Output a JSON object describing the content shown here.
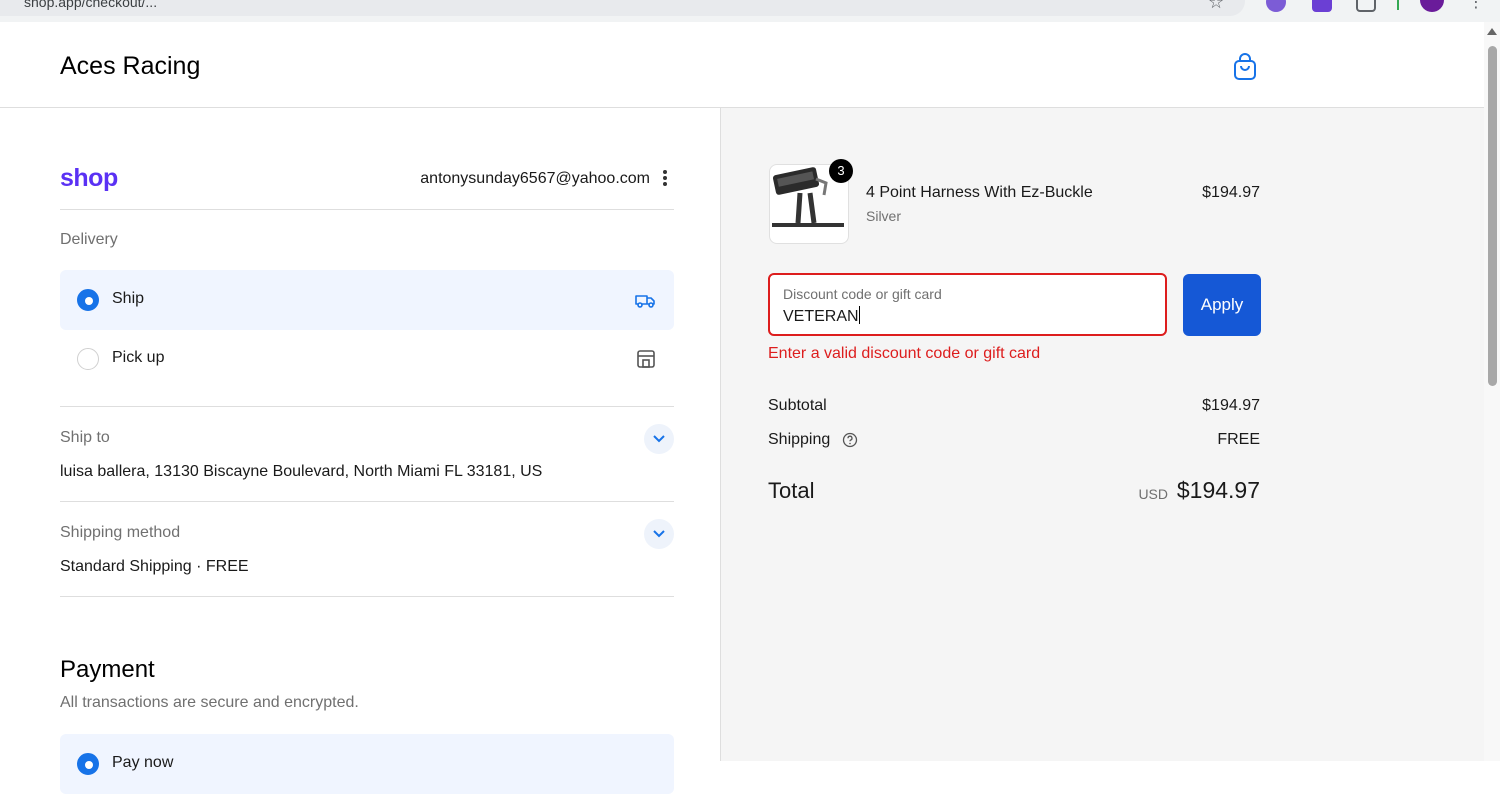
{
  "browser": {
    "url": "shop.app/checkout/...",
    "star_icon": "star-icon",
    "menu_icon": "kebab-menu-icon"
  },
  "header": {
    "store_name": "Aces Racing",
    "cart_icon": "shopping-bag-icon"
  },
  "account": {
    "shop_logo": "shop",
    "email": "antonysunday6567@yahoo.com"
  },
  "delivery": {
    "label": "Delivery",
    "options": [
      {
        "label": "Ship",
        "selected": true,
        "icon": "truck-icon"
      },
      {
        "label": "Pick up",
        "selected": false,
        "icon": "store-icon"
      }
    ]
  },
  "ship_to": {
    "label": "Ship to",
    "value": "luisa ballera, 13130 Biscayne Boulevard, North Miami FL 33181, US"
  },
  "shipping_method": {
    "label": "Shipping method",
    "value": "Standard Shipping · FREE"
  },
  "payment": {
    "title": "Payment",
    "subtitle": "All transactions are secure and encrypted.",
    "first_option": "Pay now"
  },
  "cart": {
    "items": [
      {
        "quantity": "3",
        "name": "4 Point Harness With Ez-Buckle",
        "variant": "Silver",
        "price": "$194.97"
      }
    ]
  },
  "discount": {
    "placeholder": "Discount code or gift card",
    "value": "VETERAN",
    "apply_label": "Apply",
    "error": "Enter a valid discount code or gift card"
  },
  "summary": {
    "subtotal_label": "Subtotal",
    "subtotal_value": "$194.97",
    "shipping_label": "Shipping",
    "shipping_value": "FREE",
    "total_label": "Total",
    "currency": "USD",
    "total_value": "$194.97"
  },
  "colors": {
    "accent": "#1773e8",
    "button": "#1558d6",
    "error": "#dd1d1d",
    "shop_purple": "#5a31f4"
  }
}
